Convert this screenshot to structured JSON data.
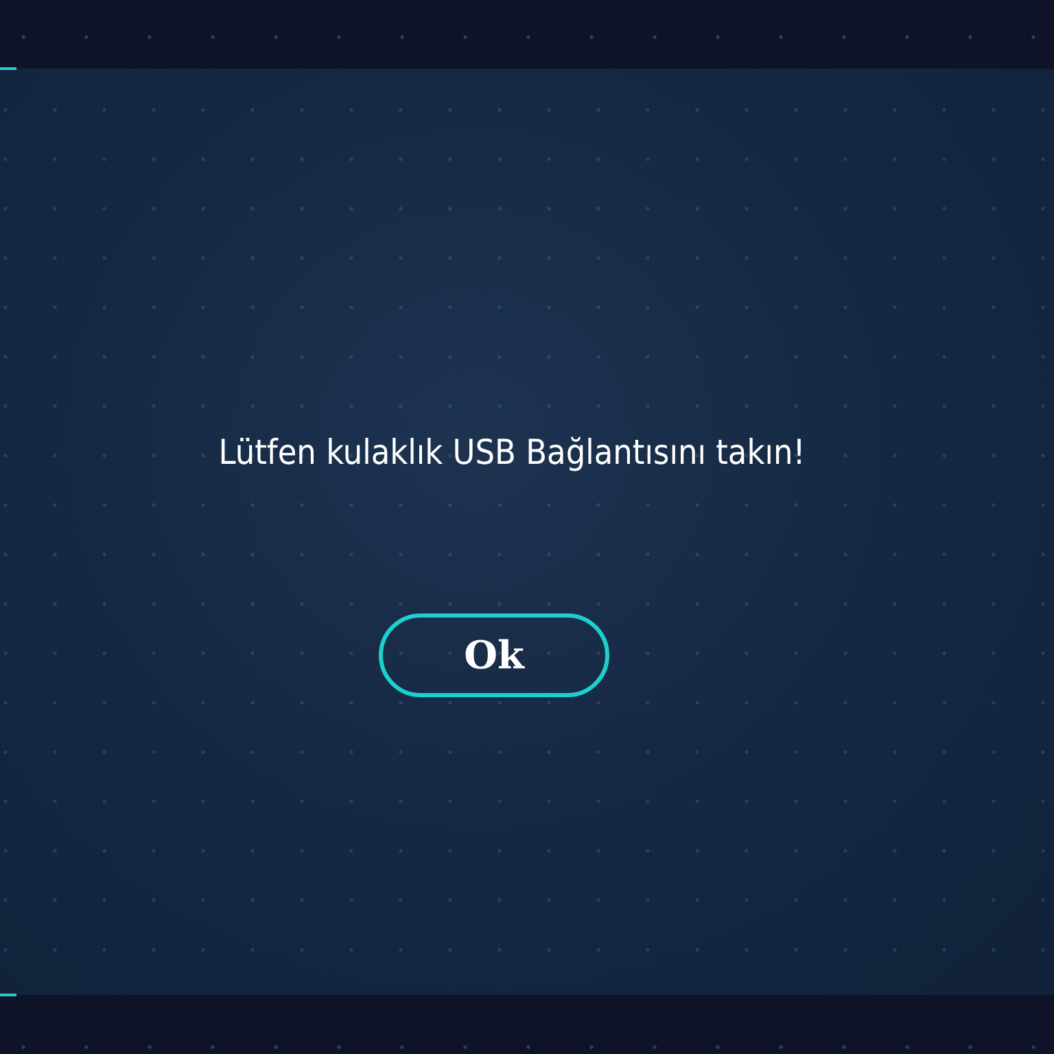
{
  "dialog": {
    "message": "Lütfen kulaklık USB Bağlantısını takın!",
    "buttons": [
      {
        "label": "Ok"
      }
    ]
  }
}
